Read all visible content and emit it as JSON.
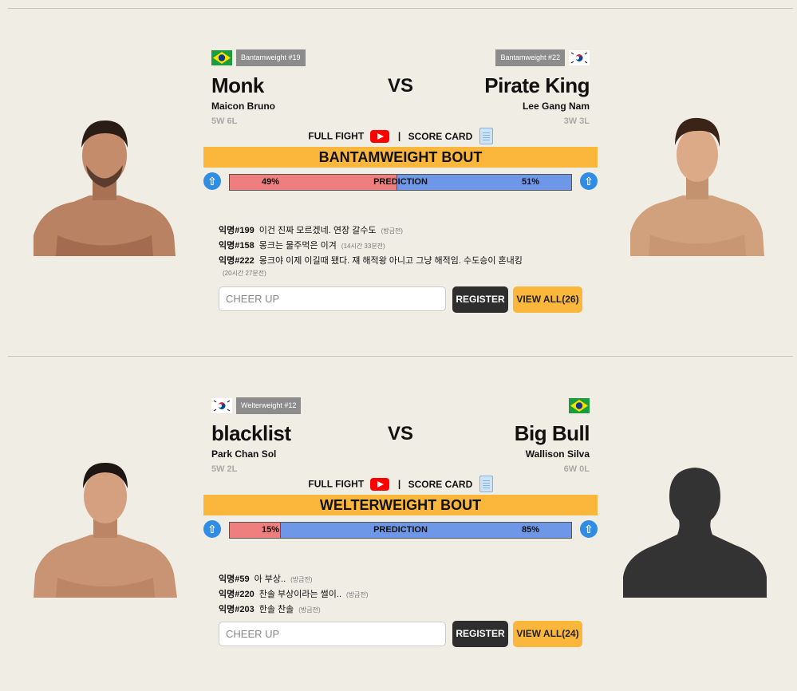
{
  "colors": {
    "background": "#f0ede4",
    "bout_bar": "#fbb73c",
    "red_side": "#ef7f7f",
    "blue_side": "#6f97e8",
    "register_btn": "#2e2e2e",
    "view_btn": "#fbb73c",
    "arrow_btn": "#2f8de4"
  },
  "bouts": [
    {
      "vs": "VS",
      "title": "BANTAMWEIGHT BOUT",
      "full_fight_label": "FULL FIGHT",
      "separator": "|",
      "score_card_label": "SCORE CARD",
      "prediction_label": "PREDICTION",
      "left": {
        "flag": "brazil-flag",
        "rank": "Bantamweight #19",
        "nickname": "Monk",
        "name": "Maicon Bruno",
        "record": "5W 6L",
        "percent_text": "49%",
        "percent": 49
      },
      "right": {
        "flag": "korea-flag",
        "rank": "Bantamweight #22",
        "nickname": "Pirate King",
        "name": "Lee Gang Nam",
        "record": "3W 3L",
        "percent_text": "51%",
        "percent": 51
      },
      "comments": [
        {
          "user": "익명#199",
          "text": "이건 진짜 모르겠네. 연장 갈수도",
          "time": "(방금전)"
        },
        {
          "user": "익명#158",
          "text": "몽크는 물주먹은 이겨",
          "time": "(14시간 33분전)"
        },
        {
          "user": "익명#222",
          "text": "몽크야 이제 이길때 됐다. 쟤 해적왕 아니고 그냥 해적임. 수도승이 혼내킹",
          "time": "(20시간 27분전)"
        }
      ],
      "cheer_placeholder": "CHEER UP",
      "register_label": "REGISTER",
      "view_all_label": "VIEW ALL(26)"
    },
    {
      "vs": "VS",
      "title": "WELTERWEIGHT BOUT",
      "full_fight_label": "FULL FIGHT",
      "separator": "|",
      "score_card_label": "SCORE CARD",
      "prediction_label": "PREDICTION",
      "left": {
        "flag": "korea-flag",
        "rank": "Welterweight #12",
        "nickname": "blacklist",
        "name": "Park Chan Sol",
        "record": "5W 2L",
        "percent_text": "15%",
        "percent": 15
      },
      "right": {
        "flag": "brazil-flag",
        "rank": "",
        "nickname": "Big Bull",
        "name": "Wallison Silva",
        "record": "6W 0L",
        "percent_text": "85%",
        "percent": 85
      },
      "comments": [
        {
          "user": "익명#59",
          "text": "아 부상..",
          "time": "(방금전)"
        },
        {
          "user": "익명#220",
          "text": "찬솔 부상이라는 썰이..",
          "time": "(방금전)"
        },
        {
          "user": "익명#203",
          "text": "한솔 찬솔",
          "time": "(방금전)"
        }
      ],
      "cheer_placeholder": "CHEER UP",
      "register_label": "REGISTER",
      "view_all_label": "VIEW ALL(24)"
    }
  ]
}
